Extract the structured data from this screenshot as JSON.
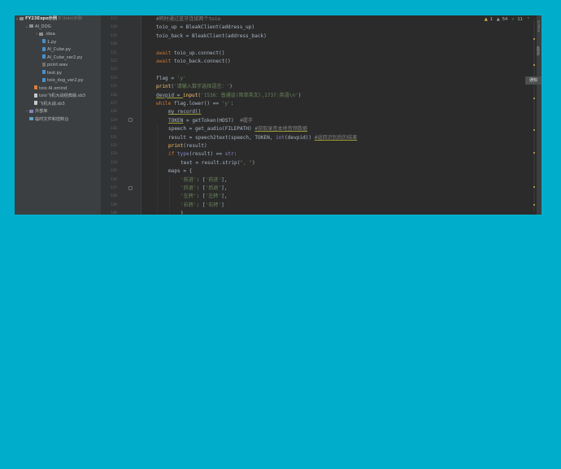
{
  "project_tree": {
    "root": {
      "label": "FY23Expo示例",
      "hint": "E:\\toio\\示例"
    },
    "items": [
      {
        "label": "AI_DOG",
        "type": "folder"
      },
      {
        "label": ".idea",
        "type": "folder"
      },
      {
        "label": "1.py",
        "type": "py"
      },
      {
        "label": "AI_Cube.py",
        "type": "py"
      },
      {
        "label": "AI_Cube_ver2.py",
        "type": "py"
      },
      {
        "label": "point.wav",
        "type": "wav"
      },
      {
        "label": "test.py",
        "type": "py"
      },
      {
        "label": "toio_dog_ver2.py",
        "type": "py"
      },
      {
        "label": "toio AI.xmind",
        "type": "xmind"
      },
      {
        "label": "toio飞机大战经典版.sb3",
        "type": "sb3"
      },
      {
        "label": "飞机大战.sb3",
        "type": "sb3"
      },
      {
        "label": "外部库",
        "type": "library"
      },
      {
        "label": "临时文件和控制台",
        "type": "scratches"
      }
    ]
  },
  "editor": {
    "line_numbers": [
      "117",
      "118",
      "119",
      "120",
      "121",
      "122",
      "123",
      "124",
      "125",
      "126",
      "127",
      "128",
      "129",
      "130",
      "131",
      "132",
      "133",
      "134",
      "135",
      "136",
      "137",
      "138",
      "139",
      "140"
    ],
    "lines": {
      "l0": {
        "comment": "#同时通过蓝牙连接两个toio"
      },
      "l1": {
        "text": "toio_up = BleakClient(address_up)"
      },
      "l2": {
        "text": "toio_back = BleakClient(address_back)"
      },
      "l4": {
        "await": "await",
        "text": " toio_up.connect()"
      },
      "l5": {
        "await": "await",
        "text": " toio_back.connect()"
      },
      "l7": {
        "text": "flag = ",
        "str": "'y'"
      },
      "l8": {
        "fn": "print",
        "open": "(",
        "str": "'请输入数字选择语言：'",
        "close": ")"
      },
      "l9": {
        "text": "devpid = ",
        "fn": "input",
        "open": "(",
        "str": "'1536：普通话(简单英文),1737:英语\\n'",
        "close": ")"
      },
      "l10": {
        "kw": "while",
        "text": " flag.lower() == ",
        "str": "'y'",
        "end": ":"
      },
      "l11": {
        "text": "my_record()"
      },
      "l12": {
        "var": "TOKEN",
        "text": " = getToken(HOST)  ",
        "comment": "#握手"
      },
      "l13": {
        "text": "speech = get_audio(FILEPATH) ",
        "comment": "#获取录音本地音频数据"
      },
      "l14": {
        "text": "result = speech2text(speech, TOKEN, ",
        "bi": "int",
        "text2": "(devpid)) ",
        "comment": "#返回识别后的结果"
      },
      "l15": {
        "fn": "print",
        "text": "(result)"
      },
      "l16": {
        "kw": "if",
        "bi": " type",
        "text": "(result) == ",
        "bi2": "str",
        "end": ":"
      },
      "l17": {
        "text": "text = result.strip(",
        "str": "\", \"",
        "end": ")"
      },
      "l18": {
        "text": "maps = {"
      },
      "l19": {
        "str": "'前进'",
        "text": ": [",
        "str2": "'前进'",
        "end": "],"
      },
      "l20": {
        "str": "'后退'",
        "text": ": [",
        "str2": "'后退'",
        "end": "],"
      },
      "l21": {
        "str": "'左转'",
        "text": ": [",
        "str2": "'左转'",
        "end": "],"
      },
      "l22": {
        "str": "'右转'",
        "text": ": [",
        "str2": "'右转'",
        "end": "]"
      },
      "l23": {
        "text": "}"
      }
    }
  },
  "status": {
    "warnings": "1",
    "weak_warnings": "54",
    "ok": "11"
  },
  "right_panel": {
    "tab1": "SciView",
    "tab2": "数据库",
    "popup": "通知"
  },
  "colors": {
    "background": "#00aecb",
    "editor_bg": "#2b2b2b",
    "tree_bg": "#3c3f41"
  }
}
